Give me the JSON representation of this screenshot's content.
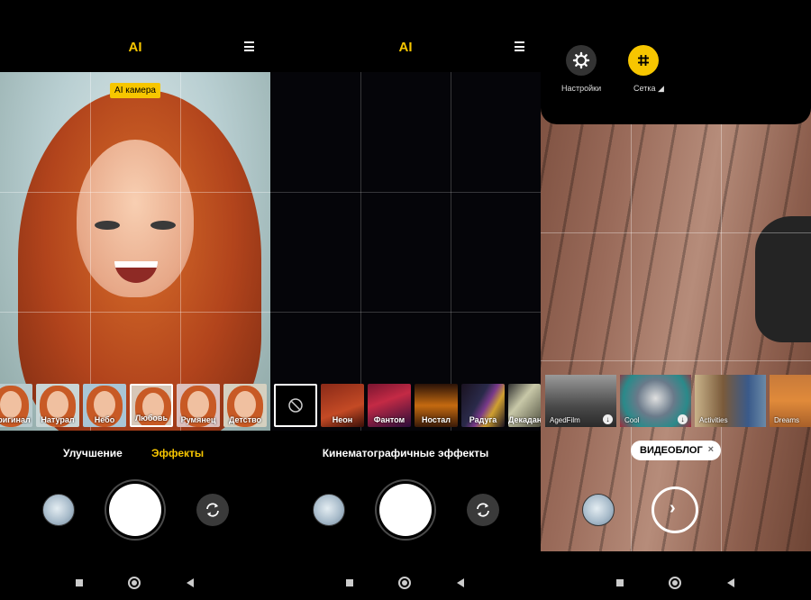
{
  "screen1": {
    "ai_label": "AI",
    "ai_badge": "AI камера",
    "filters": [
      "Оригинал",
      "Натурал",
      "Небо",
      "Любовь",
      "Румянец",
      "Детство"
    ],
    "selected_filter": "Любовь",
    "modes": [
      "Улучшение",
      "Эффекты"
    ],
    "active_mode": "Эффекты"
  },
  "screen2": {
    "ai_label": "AI",
    "effects": [
      "Неон",
      "Фантом",
      "Ностал",
      "Радуга",
      "Декадан"
    ],
    "mode_title": "Кинематографичные эффекты"
  },
  "screen3": {
    "settings_label": "Настройки",
    "grid_label": "Сетка",
    "video_filters": [
      {
        "label": "AgedFilm",
        "download": true
      },
      {
        "label": "Cool",
        "download": true
      },
      {
        "label": "Activities",
        "download": false
      },
      {
        "label": "Dreams",
        "download": false
      }
    ],
    "vlog_label": "ВИДЕОБЛОГ",
    "vlog_close": "×",
    "record_arrow": "›"
  },
  "icons": [
    "menu-icon",
    "flip-camera-icon",
    "gear-icon",
    "grid-icon",
    "no-effect-icon",
    "download-icon",
    "arrow-right-icon"
  ],
  "colors": {
    "accent": "#f7c600",
    "background": "#000000"
  }
}
